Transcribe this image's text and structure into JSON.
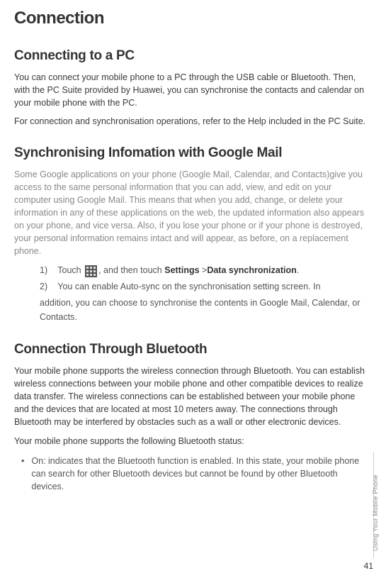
{
  "title": "Connection",
  "sections": {
    "pc": {
      "heading": "Connecting to a PC",
      "p1": "You can connect your mobile phone to a PC through the USB cable or Bluetooth. Then, with the PC Suite provided by Huawei, you can synchronise the contacts and calendar on your mobile phone with the PC.",
      "p2": "For connection and synchronisation operations, refer to the Help included in the PC Suite."
    },
    "google": {
      "heading": "Synchronising Infomation with Google Mail",
      "p1": "Some Google applications on your phone (Google Mail, Calendar, and Contacts)give you access to the same personal information that you can add, view, and edit on your computer using Google Mail. This means that when you add, change, or delete your information in any of these applications on the web, the updated information also appears on your phone, and vice versa. Also, if you lose your phone or if your phone is destroyed, your personal information remains intact and will appear, as before, on a replacement phone.",
      "step1_num": "1)",
      "step1_pre": "Touch ",
      "step1_mid": ", and then touch ",
      "step1_settings": "Settings",
      "step1_gt": " >",
      "step1_data": "Data synchronization",
      "step1_end": ".",
      "step2_num": "2)",
      "step2": "You can enable Auto-sync on the synchronisation setting screen. In",
      "step2_cont": "addition, you can choose to synchronise the contents in Google Mail, Calendar, or Contacts."
    },
    "bluetooth": {
      "heading": "Connection Through Bluetooth",
      "p1": "Your mobile phone supports the wireless connection through Bluetooth. You can establish wireless connections between your mobile phone and other compatible devices to realize data transfer. The wireless connections can be established between your mobile phone and the devices that are located at most 10 meters away. The connections through Bluetooth may be interfered by obstacles such as a wall or other electronic devices.",
      "p2": "Your mobile phone supports the following Bluetooth status:",
      "bullet1": "On: indicates that the Bluetooth function is enabled. In this state, your mobile phone can search for other Bluetooth devices but cannot be found by other Bluetooth devices."
    }
  },
  "sideLabel": "Using Your Mobile Phone",
  "pageNumber": "41"
}
